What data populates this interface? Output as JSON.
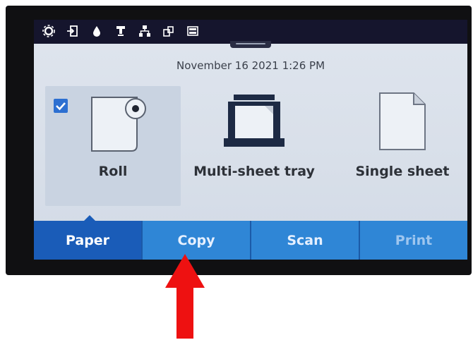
{
  "status_bar": {
    "icons": [
      "settings-icon",
      "sign-in-icon",
      "ink-drop-icon",
      "printhead-icon",
      "network-icon",
      "share-icon",
      "storage-icon"
    ]
  },
  "datetime": "November 16 2021 1:26 PM",
  "sources": [
    {
      "label": "Roll",
      "selected": true
    },
    {
      "label": "Multi-sheet tray",
      "selected": false
    },
    {
      "label": "Single sheet",
      "selected": false
    }
  ],
  "tabs": [
    {
      "label": "Paper",
      "active": true
    },
    {
      "label": "Copy",
      "active": false
    },
    {
      "label": "Scan",
      "active": false
    },
    {
      "label": "Print",
      "active": false
    }
  ],
  "colors": {
    "tab_active": "#1a5cb8",
    "tab_default": "#2f86d6",
    "checkbox": "#2c6fd1",
    "annotation_arrow": "#ee1111"
  }
}
